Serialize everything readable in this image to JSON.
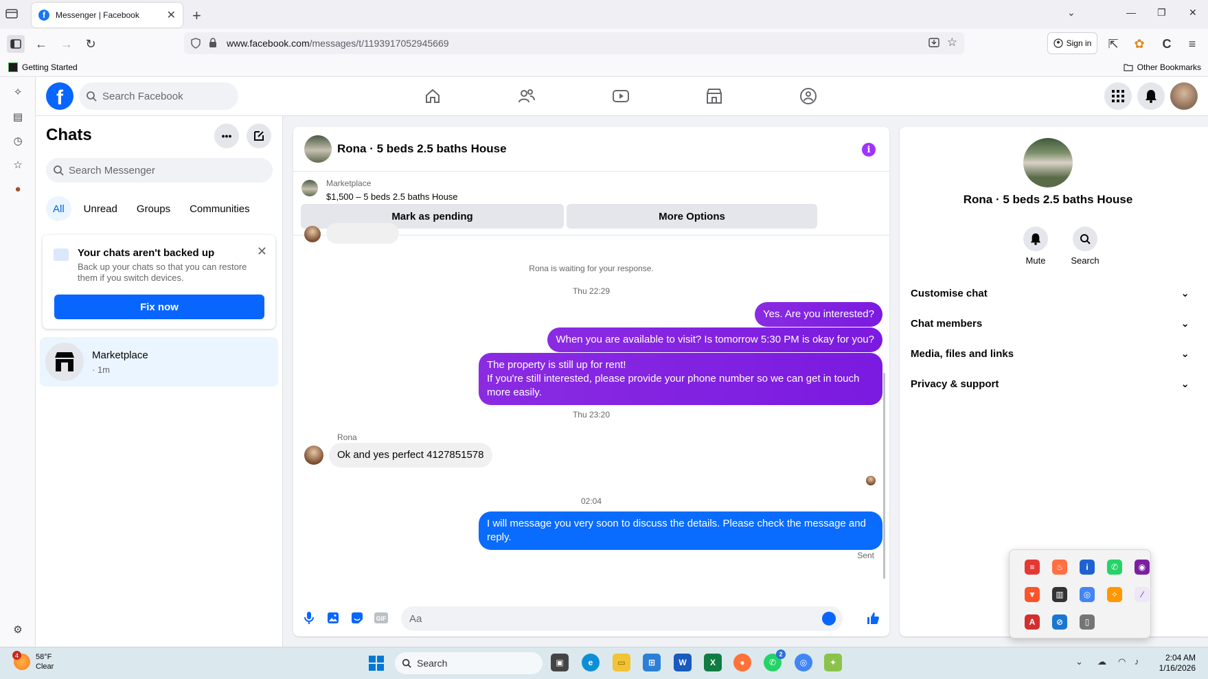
{
  "browser": {
    "tab_title": "Messenger | Facebook",
    "url_domain": "www.facebook.com",
    "url_path": "/messages/t/1193917052945669",
    "sign_in": "Sign in",
    "bookmark_left": "Getting Started",
    "bookmark_right": "Other Bookmarks"
  },
  "fb_header": {
    "logo": "f",
    "search_placeholder": "Search Facebook",
    "nav_icons": [
      "home-icon",
      "friends-icon",
      "video-icon",
      "marketplace-icon",
      "groups-icon"
    ]
  },
  "chats": {
    "title": "Chats",
    "search_placeholder": "Search Messenger",
    "filters": [
      "All",
      "Unread",
      "Groups",
      "Communities"
    ],
    "backup": {
      "title": "Your chats aren't backed up",
      "body": "Back up your chats so that you can restore them if you switch devices.",
      "button": "Fix now"
    },
    "list": [
      {
        "name": "Marketplace",
        "time": "· 1m"
      }
    ]
  },
  "conversation": {
    "title": "Rona · 5 beds 2.5 baths House",
    "listing_source": "Marketplace",
    "listing_desc": "$1,500 – 5 beds 2.5 baths House",
    "mark_pending": "Mark as pending",
    "more_options": "More Options",
    "waiting": "Rona is waiting for your response.",
    "ts1": "Thu 22:29",
    "msg1": "Yes. Are you interested?",
    "msg2": "When you are available to visit? Is tomorrow 5:30 PM is okay for you?",
    "msg3_line1": "The property is still up for rent!",
    "msg3_line2": "If you're still interested, please provide your phone number so we can get in touch more easily.",
    "ts2": "Thu 23:20",
    "sender": "Rona",
    "msg4": "Ok and yes perfect 4127851578",
    "ts3": "02:04",
    "msg5": "I will message you very soon to discuss the details. Please check the message and reply.",
    "sent": "Sent",
    "composer_placeholder": "Aa"
  },
  "info_panel": {
    "title": "Rona · 5 beds 2.5 baths House",
    "mute": "Mute",
    "search": "Search",
    "sections": [
      "Customise chat",
      "Chat members",
      "Media, files and links",
      "Privacy & support"
    ]
  },
  "taskbar": {
    "weather_badge": "4",
    "temp": "58°F",
    "condition": "Clear",
    "search": "Search",
    "whatsapp_badge": "2",
    "time": "2:04 AM",
    "date": "1/16/2026"
  },
  "colors": {
    "fb_blue": "#0866ff",
    "purple_bubble": "#8a2be2",
    "blue_bubble": "#0a6cff"
  }
}
